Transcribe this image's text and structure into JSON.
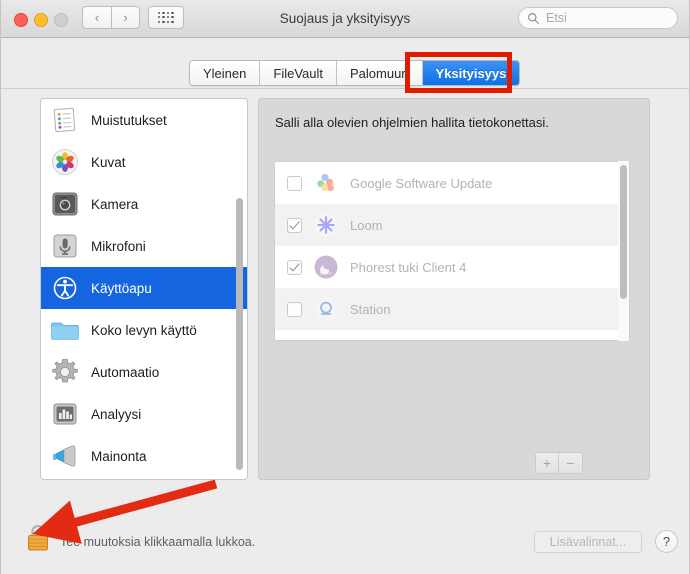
{
  "window": {
    "title": "Suojaus ja yksityisyys",
    "traffic_lights": [
      "close",
      "minimize",
      "maximize"
    ]
  },
  "toolbar": {
    "back_glyph": "‹",
    "forward_glyph": "›",
    "grid_name": "show-all-button"
  },
  "search": {
    "placeholder": "Etsi",
    "value": ""
  },
  "tabs": [
    {
      "label": "Yleinen",
      "active": false
    },
    {
      "label": "FileVault",
      "active": false
    },
    {
      "label": "Palomuuri",
      "active": false
    },
    {
      "label": "Yksityisyys",
      "active": true
    }
  ],
  "sidebar": {
    "items": [
      {
        "label": "Muistutukset",
        "icon": "reminders-icon",
        "selected": false
      },
      {
        "label": "Kuvat",
        "icon": "photos-icon",
        "selected": false
      },
      {
        "label": "Kamera",
        "icon": "camera-icon",
        "selected": false
      },
      {
        "label": "Mikrofoni",
        "icon": "microphone-icon",
        "selected": false
      },
      {
        "label": "Käyttöapu",
        "icon": "accessibility-icon",
        "selected": true
      },
      {
        "label": "Koko levyn käyttö",
        "icon": "folder-icon",
        "selected": false
      },
      {
        "label": "Automaatio",
        "icon": "gear-icon",
        "selected": false
      },
      {
        "label": "Analyysi",
        "icon": "analytics-icon",
        "selected": false
      },
      {
        "label": "Mainonta",
        "icon": "megaphone-icon",
        "selected": false
      }
    ]
  },
  "main": {
    "description": "Salli alla olevien ohjelmien hallita tietokonettasi.",
    "apps": [
      {
        "name": "Google Software Update",
        "checked": false,
        "icon": "google-update-icon"
      },
      {
        "name": "Loom",
        "checked": true,
        "icon": "loom-icon"
      },
      {
        "name": "Phorest tuki Client 4",
        "checked": true,
        "icon": "phorest-icon"
      },
      {
        "name": "Station",
        "checked": false,
        "icon": "station-icon"
      }
    ],
    "add_label": "+",
    "remove_label": "−"
  },
  "footer": {
    "lock_text": "Tee muutoksia klikkaamalla lukkoa.",
    "lock_state": "locked",
    "more_options_label": "Lisävalinnat...",
    "help_label": "?"
  },
  "annotations": {
    "highlight_color": "#e01b00",
    "arrow_color": "#e32b14",
    "highlight_target": "Yksityisyys",
    "arrow_target": "lock-icon"
  }
}
